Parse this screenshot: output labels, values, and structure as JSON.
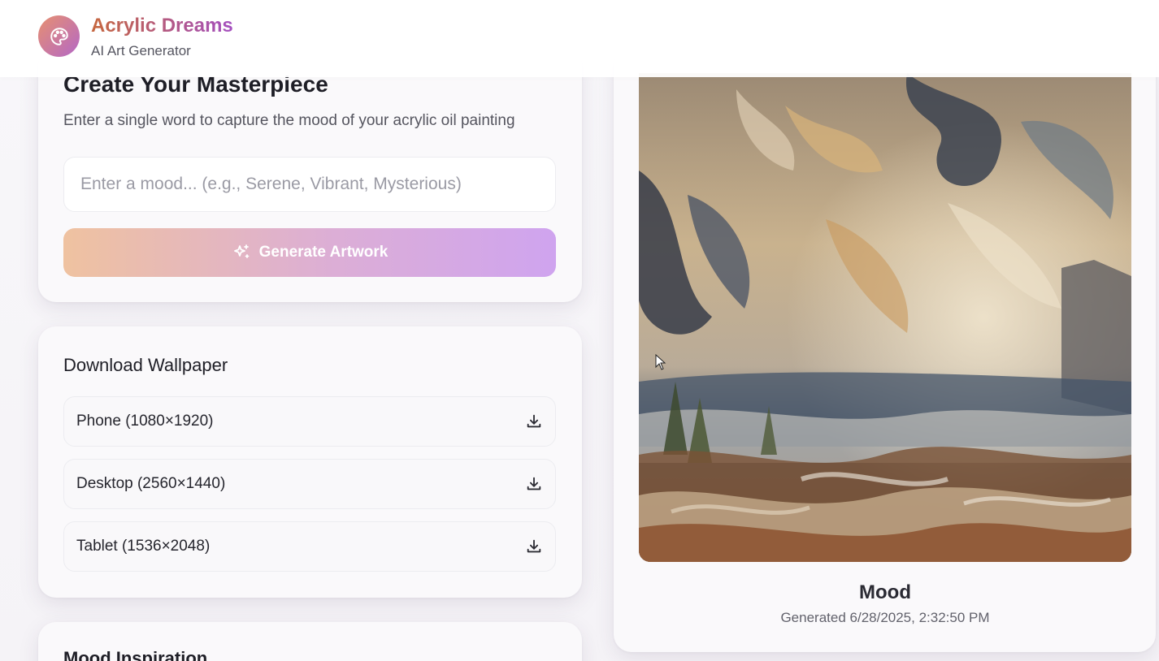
{
  "header": {
    "title": "Acrylic Dreams",
    "subtitle": "AI Art Generator",
    "logo_icon": "palette-icon"
  },
  "create": {
    "title": "Create Your Masterpiece",
    "description": "Enter a single word to capture the mood of your acrylic oil painting",
    "input_placeholder": "Enter a mood... (e.g., Serene, Vibrant, Mysterious)",
    "input_value": "",
    "generate_label": "Generate Artwork",
    "generate_icon": "sparkles-icon"
  },
  "download": {
    "title": "Download Wallpaper",
    "options": [
      {
        "label": "Phone (1080×1920)",
        "icon": "download-icon"
      },
      {
        "label": "Desktop (2560×1440)",
        "icon": "download-icon"
      },
      {
        "label": "Tablet (1536×2048)",
        "icon": "download-icon"
      }
    ]
  },
  "inspiration": {
    "title": "Mood Inspiration"
  },
  "artwork": {
    "caption": "Mood",
    "generated": "Generated 6/28/2025, 2:32:50 PM"
  },
  "colors": {
    "brand_start": "#c6673e",
    "brand_end": "#a44fc0",
    "button_start": "#efc2a0",
    "button_end": "#cfa4ef"
  }
}
